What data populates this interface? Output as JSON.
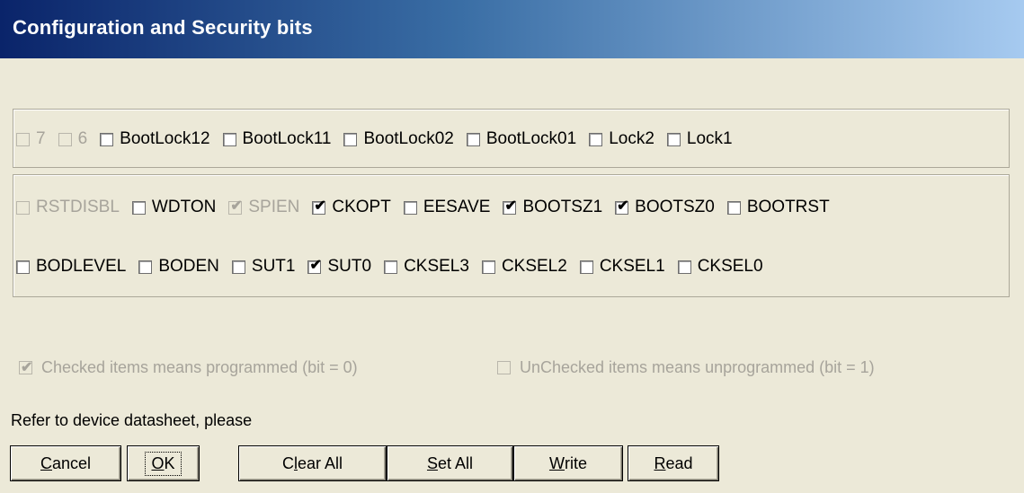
{
  "window": {
    "title": "Configuration and Security bits"
  },
  "lock_bits": [
    {
      "label": "7",
      "checked": false,
      "disabled": true
    },
    {
      "label": "6",
      "checked": false,
      "disabled": true
    },
    {
      "label": "BootLock12",
      "checked": false,
      "disabled": false
    },
    {
      "label": "BootLock11",
      "checked": false,
      "disabled": false
    },
    {
      "label": "BootLock02",
      "checked": false,
      "disabled": false
    },
    {
      "label": "BootLock01",
      "checked": false,
      "disabled": false
    },
    {
      "label": "Lock2",
      "checked": false,
      "disabled": false
    },
    {
      "label": "Lock1",
      "checked": false,
      "disabled": false
    }
  ],
  "fuse_high": [
    {
      "label": "RSTDISBL",
      "checked": false,
      "disabled": true
    },
    {
      "label": "WDTON",
      "checked": false,
      "disabled": false
    },
    {
      "label": "SPIEN",
      "checked": true,
      "disabled": true
    },
    {
      "label": "CKOPT",
      "checked": true,
      "disabled": false
    },
    {
      "label": "EESAVE",
      "checked": false,
      "disabled": false
    },
    {
      "label": "BOOTSZ1",
      "checked": true,
      "disabled": false
    },
    {
      "label": "BOOTSZ0",
      "checked": true,
      "disabled": false
    },
    {
      "label": "BOOTRST",
      "checked": false,
      "disabled": false
    }
  ],
  "fuse_low": [
    {
      "label": "BODLEVEL",
      "checked": false,
      "disabled": false
    },
    {
      "label": "BODEN",
      "checked": false,
      "disabled": false
    },
    {
      "label": "SUT1",
      "checked": false,
      "disabled": false
    },
    {
      "label": "SUT0",
      "checked": true,
      "disabled": false
    },
    {
      "label": "CKSEL3",
      "checked": false,
      "disabled": false
    },
    {
      "label": "CKSEL2",
      "checked": false,
      "disabled": false
    },
    {
      "label": "CKSEL1",
      "checked": false,
      "disabled": false
    },
    {
      "label": "CKSEL0",
      "checked": false,
      "disabled": false
    }
  ],
  "legend": {
    "checked_text": "Checked items means programmed (bit = 0)",
    "unchecked_text": "UnChecked items means unprogrammed (bit = 1)"
  },
  "note": "Refer to device datasheet, please",
  "buttons": {
    "cancel": {
      "prefix": "",
      "mnemonic": "C",
      "rest": "ancel"
    },
    "ok": {
      "prefix": "",
      "mnemonic": "O",
      "rest": "K"
    },
    "clear_all": {
      "prefix": "C",
      "mnemonic": "l",
      "rest": "ear All"
    },
    "set_all": {
      "prefix": "",
      "mnemonic": "S",
      "rest": "et All"
    },
    "write": {
      "prefix": "",
      "mnemonic": "W",
      "rest": "rite"
    },
    "read": {
      "prefix": "",
      "mnemonic": "R",
      "rest": "ead"
    }
  },
  "icons": {
    "check_glyph": "✔"
  }
}
